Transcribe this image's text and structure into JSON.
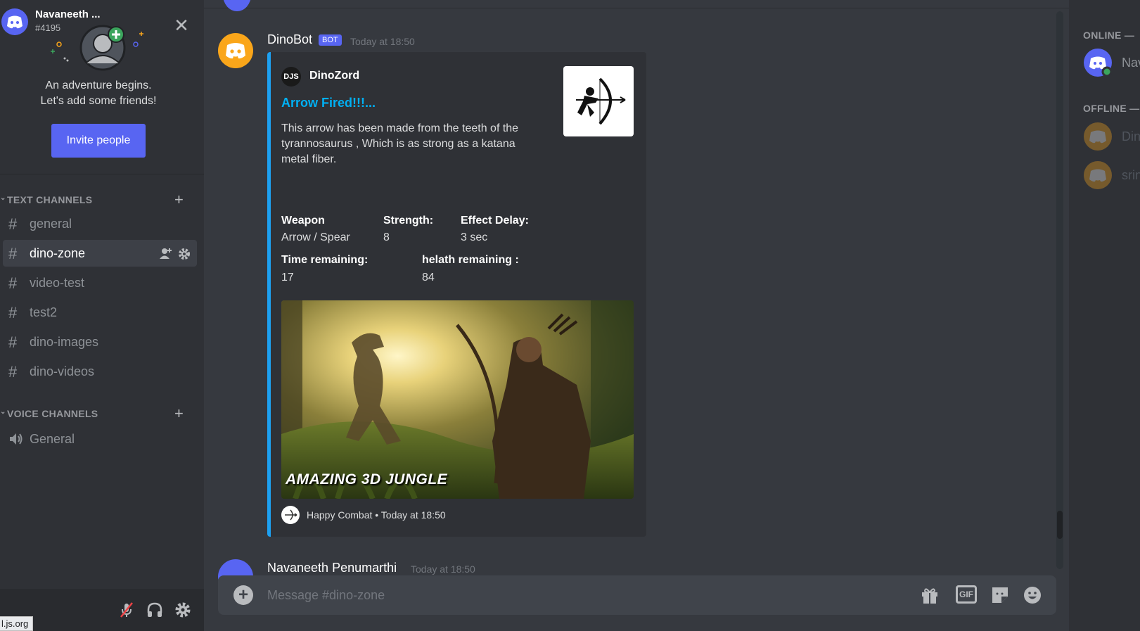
{
  "welcome": {
    "line1": "An adventure begins.",
    "line2": "Let's add some friends!",
    "invite_label": "Invite people"
  },
  "sidebar": {
    "text_category": "TEXT CHANNELS",
    "voice_category": "VOICE CHANNELS",
    "text_channels": [
      "general",
      "dino-zone",
      "video-test",
      "test2",
      "dino-images",
      "dino-videos"
    ],
    "active_channel": "dino-zone",
    "voice_channels": [
      "General"
    ]
  },
  "user_panel": {
    "name": "Navaneeth ...",
    "tag": "#4195",
    "url_tooltip": "l.js.org"
  },
  "message1": {
    "author": "DinoBot",
    "badge": "BOT",
    "time": "Today at 18:50",
    "embed": {
      "accent_color": "#1da1f2",
      "author_icon_text": "DJS",
      "author": "DinoZord",
      "title": "Arrow Fired!!!...",
      "description": "This arrow has been made from the teeth of the tyrannosaurus , Which is as strong as a katana metal fiber.",
      "fields": [
        {
          "name": "Weapon",
          "value": "Arrow / Spear"
        },
        {
          "name": "Strength:",
          "value": "8"
        },
        {
          "name": "Effect Delay:",
          "value": "3 sec"
        },
        {
          "name": "Time remaining:",
          "value": "17"
        },
        {
          "name": "helath remaining :",
          "value": "84"
        }
      ],
      "image_caption": "AMAZING 3D JUNGLE",
      "footer": "Happy Combat • Today at 18:50"
    }
  },
  "message2": {
    "author": "Navaneeth Penumarthi",
    "time": "Today at 18:50"
  },
  "composer": {
    "placeholder": "Message #dino-zone",
    "gif_label": "GIF"
  },
  "members": {
    "online_header": "ONLINE —",
    "offline_header": "OFFLINE —",
    "online": [
      {
        "name": "Nav"
      }
    ],
    "offline": [
      {
        "name": "Din"
      },
      {
        "name": "srin"
      }
    ]
  },
  "colors": {
    "blurple": "#5865f2",
    "bot_avatar": "#faa61a",
    "link": "#00b0f4",
    "online": "#3ba55d"
  }
}
